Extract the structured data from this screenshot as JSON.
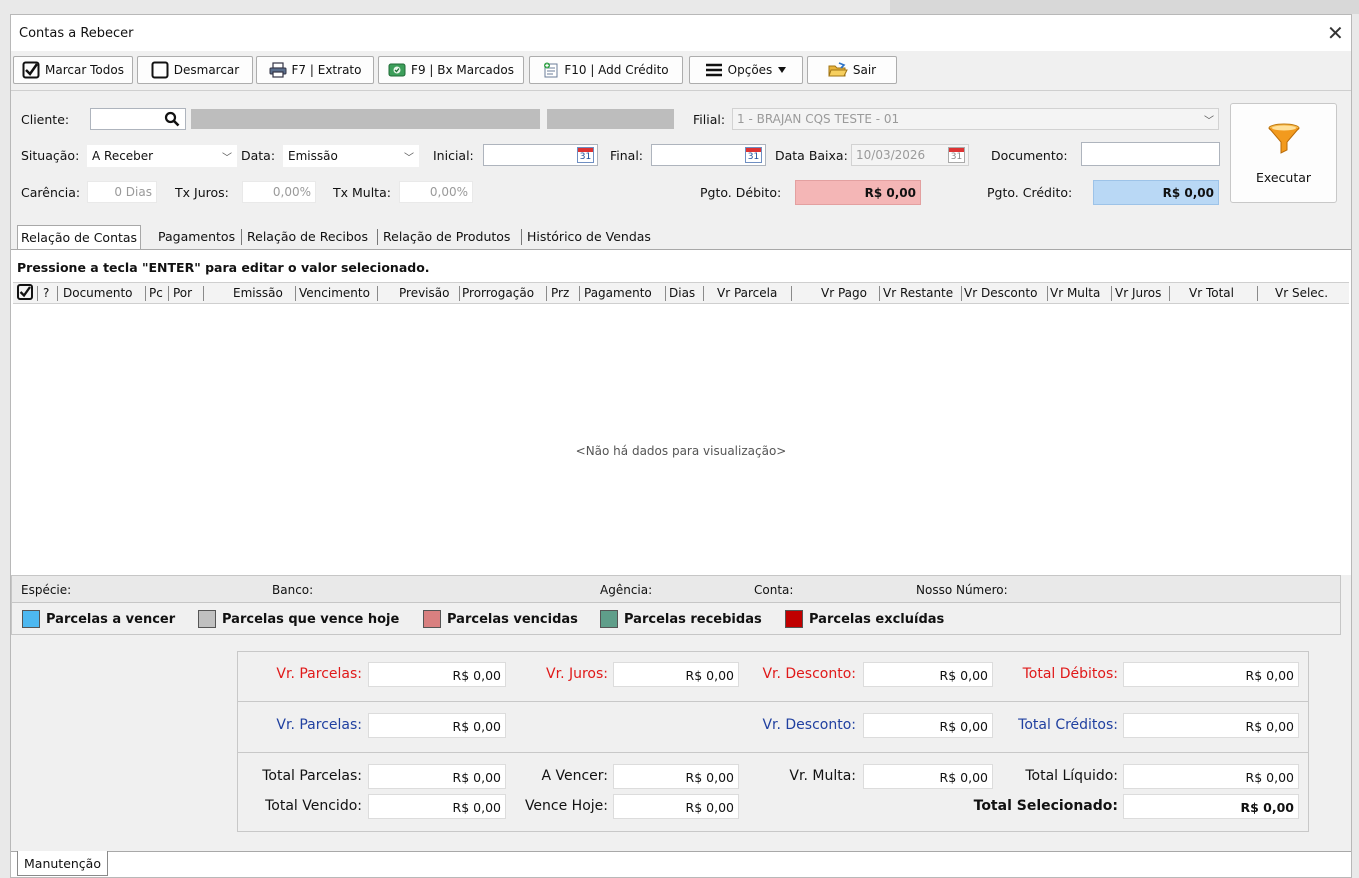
{
  "window": {
    "title": "Contas a Rebecer"
  },
  "toolbar": {
    "mark_all": "Marcar Todos",
    "unmark": "Desmarcar",
    "statement": "F7 | Extrato",
    "settle_marked": "F9 | Bx Marcados",
    "add_credit": "F10 | Add Crédito",
    "options": "Opções",
    "exit": "Sair"
  },
  "filters": {
    "cliente_label": "Cliente:",
    "cliente_value": "",
    "filial_label": "Filial:",
    "filial_value": "1 - BRAJAN CQS TESTE - 01",
    "situacao_label": "Situação:",
    "situacao_value": "A Receber",
    "data_label": "Data:",
    "data_value": "Emissão",
    "inicial_label": "Inicial:",
    "inicial_value": "",
    "final_label": "Final:",
    "final_value": "",
    "data_baixa_label": "Data Baixa:",
    "data_baixa_value": "10/03/2026",
    "documento_label": "Documento:",
    "documento_value": "",
    "carencia_label": "Carência:",
    "carencia_value": "0 Dias",
    "tx_juros_label": "Tx Juros:",
    "tx_juros_value": "0,00%",
    "tx_multa_label": "Tx Multa:",
    "tx_multa_value": "0,00%",
    "pgto_debito_label": "Pgto. Débito:",
    "pgto_debito_value": "R$ 0,00",
    "pgto_credito_label": "Pgto. Crédito:",
    "pgto_credito_value": "R$ 0,00",
    "calendar_day": "31"
  },
  "execute_label": "Executar",
  "tabs": [
    "Relação de Contas",
    "Pagamentos",
    "Relação de Recibos",
    "Relação de Produtos",
    "Histórico de Vendas"
  ],
  "grid": {
    "hint": "Pressione a tecla \"ENTER\" para editar o valor selecionado.",
    "columns": [
      "?",
      "Documento",
      "Pc",
      "Por",
      "Emissão",
      "Vencimento",
      "Previsão",
      "Prorrogação",
      "Prz",
      "Pagamento",
      "Dias",
      "Vr Parcela",
      "Vr Pago",
      "Vr Restante",
      "Vr Desconto",
      "Vr Multa",
      "Vr Juros",
      "Vr Total",
      "Vr Selec."
    ],
    "empty": "<Não há dados para visualização>"
  },
  "info": {
    "especie": "Espécie:",
    "banco": "Banco:",
    "agencia": "Agência:",
    "conta": "Conta:",
    "nosso_numero": "Nosso Número:"
  },
  "legend": [
    {
      "label": "Parcelas a vencer",
      "color": "#4db8f0"
    },
    {
      "label": "Parcelas que vence hoje",
      "color": "#c0c0c0"
    },
    {
      "label": "Parcelas vencidas",
      "color": "#d98080"
    },
    {
      "label": "Parcelas recebidas",
      "color": "#5f9e8a"
    },
    {
      "label": "Parcelas excluídas",
      "color": "#c00000"
    }
  ],
  "totals": {
    "debit": {
      "vr_parcelas_label": "Vr. Parcelas:",
      "vr_parcelas": "R$ 0,00",
      "vr_juros_label": "Vr. Juros:",
      "vr_juros": "R$ 0,00",
      "vr_desconto_label": "Vr. Desconto:",
      "vr_desconto": "R$ 0,00",
      "total_label": "Total Débitos:",
      "total": "R$ 0,00"
    },
    "credit": {
      "vr_parcelas_label": "Vr. Parcelas:",
      "vr_parcelas": "R$ 0,00",
      "vr_desconto_label": "Vr. Desconto:",
      "vr_desconto": "R$ 0,00",
      "total_label": "Total Créditos:",
      "total": "R$ 0,00"
    },
    "summary": {
      "total_parcelas_label": "Total Parcelas:",
      "total_parcelas": "R$ 0,00",
      "a_vencer_label": "A Vencer:",
      "a_vencer": "R$ 0,00",
      "vr_multa_label": "Vr. Multa:",
      "vr_multa": "R$ 0,00",
      "total_liquido_label": "Total Líquido:",
      "total_liquido": "R$ 0,00",
      "total_vencido_label": "Total Vencido:",
      "total_vencido": "R$ 0,00",
      "vence_hoje_label": "Vence Hoje:",
      "vence_hoje": "R$ 0,00",
      "total_selecionado_label": "Total Selecionado:",
      "total_selecionado": "R$ 0,00"
    }
  },
  "bottom_tab": "Manutenção",
  "colors": {
    "debit_bg": "#f4b6b6",
    "credit_bg": "#b9d8f5",
    "debit_text": "#e01919",
    "credit_text": "#2040a0"
  }
}
